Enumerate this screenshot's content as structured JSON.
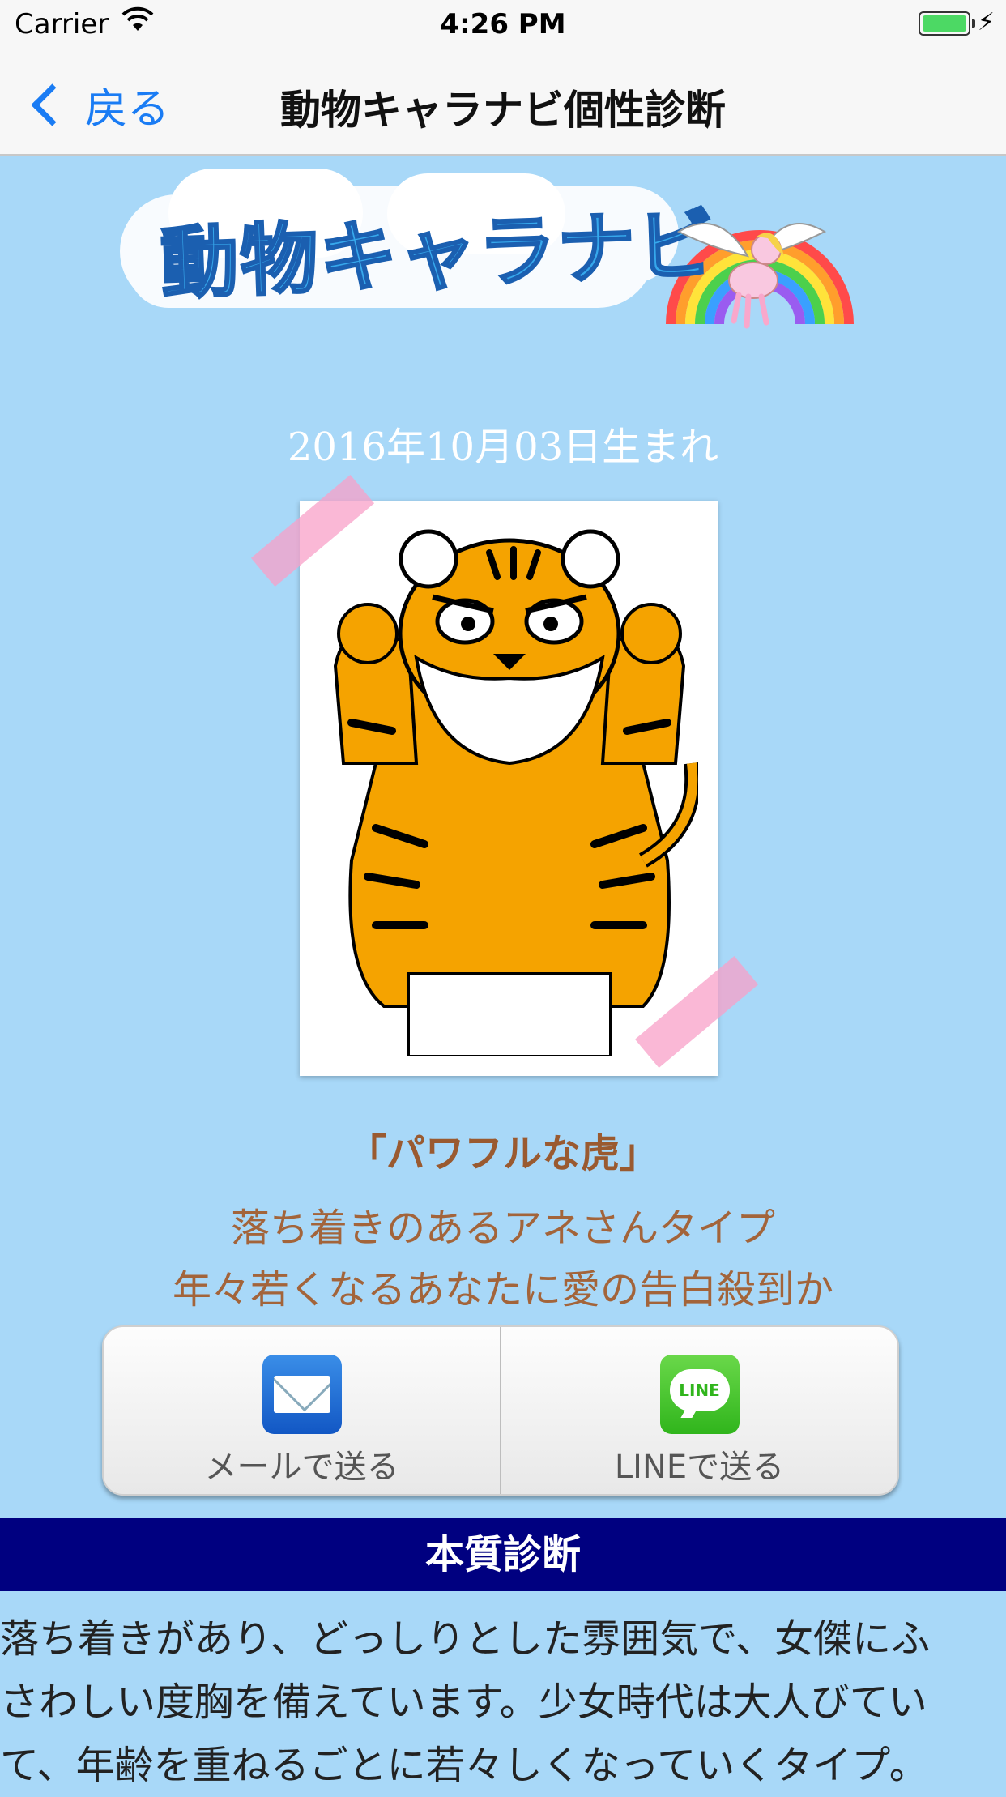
{
  "status_bar": {
    "carrier": "Carrier",
    "time": "4:26 PM"
  },
  "nav": {
    "back_label": "戻る",
    "title": "動物キャラナビ個性診断"
  },
  "logo": {
    "text": "動物キャラナビ"
  },
  "birth_date": "2016年10月03日生まれ",
  "character": {
    "type": "「パワフルな虎」",
    "line1": "落ち着きのあるアネさんタイプ",
    "line2": "年々若くなるあなたに愛の告白殺到か"
  },
  "share": {
    "mail_label": "メールで送る",
    "line_label": "LINEで送る",
    "line_icon_text": "LINE"
  },
  "section": {
    "title": "本質診断",
    "body_lines": [
      "落ち着きがあり、どっしりとした雰囲気で、女傑にふ",
      "さわしい度胸を備えています。少女時代は大人びてい",
      "て、年齢を重ねるごとに若々しくなっていくタイプ。"
    ]
  },
  "colors": {
    "background": "#a8d8f8",
    "nav_tint": "#1a7cf4",
    "section_header": "#000080",
    "accent_text": "#a3643a"
  },
  "icons": [
    "wifi-icon",
    "battery-icon",
    "charging-icon",
    "back-chevron-icon",
    "mail-icon",
    "line-icon"
  ]
}
